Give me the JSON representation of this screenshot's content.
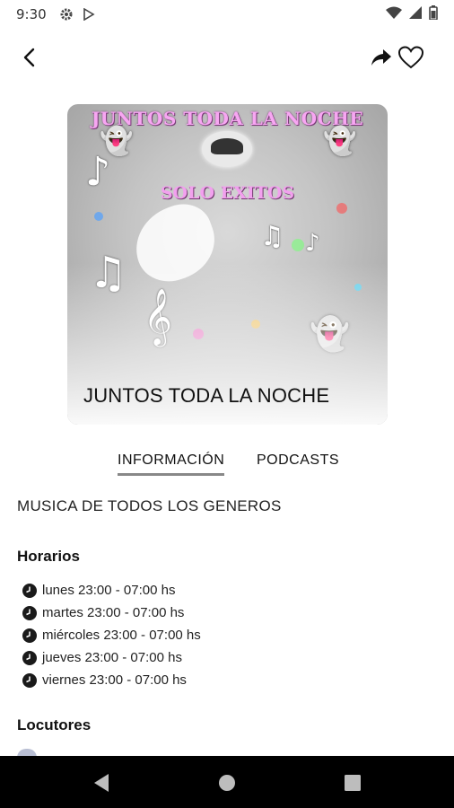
{
  "status_bar": {
    "time": "9:30",
    "icons": [
      "gear-icon",
      "play-store-icon",
      "wifi-icon",
      "signal-icon",
      "battery-icon"
    ]
  },
  "app_bar": {
    "icons": [
      "back-arrow-icon",
      "share-icon",
      "heart-icon"
    ]
  },
  "cover": {
    "art_title": "JUNTOS TODA LA NOCHE",
    "art_subtitle": "SOLO EXITOS",
    "program_name": "JUNTOS TODA LA NOCHE"
  },
  "tabs": [
    {
      "label": "INFORMACIÓN",
      "active": true
    },
    {
      "label": "PODCASTS",
      "active": false
    }
  ],
  "description": "MUSICA DE TODOS LOS GENEROS",
  "horarios": {
    "title": "Horarios",
    "items": [
      "lunes 23:00 - 07:00 hs",
      "martes 23:00 - 07:00 hs",
      "miércoles 23:00 - 07:00 hs",
      "jueves 23:00 - 07:00 hs",
      "viernes 23:00 - 07:00 hs"
    ]
  },
  "locutores": {
    "title": "Locutores"
  },
  "nav_bar": {
    "icons": [
      "nav-back-icon",
      "nav-home-icon",
      "nav-recent-icon"
    ]
  },
  "colors": {
    "accent_underline": "#888888",
    "nav_background": "#000000",
    "art_title_pink": "#f7a6f2"
  }
}
